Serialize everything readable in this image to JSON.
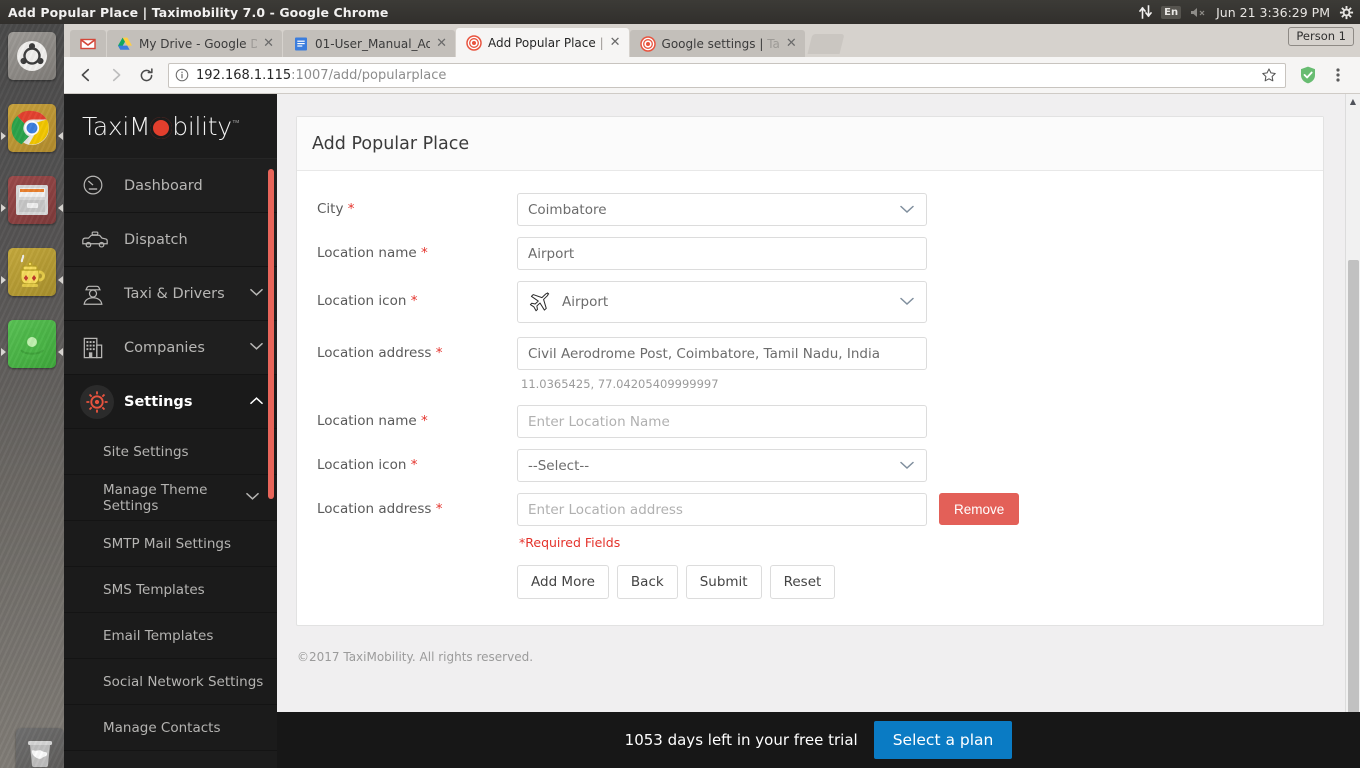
{
  "os_panel": {
    "window_title": "Add Popular Place | Taximobility 7.0 - Google Chrome",
    "tray": {
      "network_icon": "network-updown-icon",
      "keyboard_layout": "En",
      "volume_icon": "volume-muted-icon",
      "clock": "Jun 21  3:36:29 PM",
      "system_icon": "system-gear-icon"
    }
  },
  "launcher": {
    "items": [
      {
        "name": "ubuntu-dash-icon",
        "label": "Ubuntu Dash"
      },
      {
        "name": "google-chrome-icon",
        "label": "Google Chrome"
      },
      {
        "name": "file-manager-icon",
        "label": "Files"
      },
      {
        "name": "genymotion-icon",
        "label": "Genymotion"
      },
      {
        "name": "android-studio-icon",
        "label": "Android Emulator"
      }
    ],
    "trash": {
      "name": "trash-icon",
      "label": "Trash"
    }
  },
  "browser": {
    "tabs": [
      {
        "title": "",
        "favicon": "gmail-icon",
        "active": false,
        "closable": false
      },
      {
        "title": "My Drive - Google ",
        "title_dim": "D",
        "favicon": "google-drive-icon",
        "active": false,
        "closable": true
      },
      {
        "title": "01-User_Manual_Ad",
        "title_dim": "",
        "favicon": "google-docs-icon",
        "active": false,
        "closable": true
      },
      {
        "title": "Add Popular Place ",
        "title_dim": "|",
        "favicon": "taximobility-icon",
        "active": true,
        "closable": true
      },
      {
        "title": "Google settings | ",
        "title_dim": "Ta",
        "favicon": "taximobility-icon",
        "active": false,
        "closable": true
      }
    ],
    "new_tab_label": "+",
    "profile_label": "Person 1",
    "toolbar": {
      "back_icon": "back-arrow-icon",
      "forward_icon": "forward-arrow-icon",
      "reload_icon": "reload-icon",
      "info_icon": "page-info-icon",
      "url_host": "192.168.1.115",
      "url_rest": ":1007/add/popularplace",
      "bookmark_icon": "star-icon",
      "extension_icon": "shield-extension-icon",
      "menu_icon": "three-dot-menu-icon"
    }
  },
  "sidebar": {
    "brand": {
      "pre": "TaxiM",
      "post": "bility",
      "tm": "™"
    },
    "items": [
      {
        "label": "Dashboard",
        "icon": "speedometer-icon",
        "expandable": false,
        "active": false
      },
      {
        "label": "Dispatch",
        "icon": "taxi-icon",
        "expandable": false,
        "active": false
      },
      {
        "label": "Taxi & Drivers",
        "icon": "driver-icon",
        "expandable": true,
        "chevron": "down",
        "active": false
      },
      {
        "label": "Companies",
        "icon": "building-icon",
        "expandable": true,
        "chevron": "down",
        "active": false
      },
      {
        "label": "Settings",
        "icon": "gear-icon",
        "expandable": true,
        "chevron": "up",
        "active": true
      }
    ],
    "subitems": [
      {
        "label": "Site Settings",
        "expandable": false
      },
      {
        "label": "Manage Theme Settings",
        "expandable": true,
        "chevron": "down"
      },
      {
        "label": "SMTP Mail Settings",
        "expandable": false
      },
      {
        "label": "SMS Templates",
        "expandable": false
      },
      {
        "label": "Email Templates",
        "expandable": false
      },
      {
        "label": "Social Network Settings",
        "expandable": false
      },
      {
        "label": "Manage Contacts",
        "expandable": false
      }
    ],
    "scrollbar_color": "#e8655a"
  },
  "page": {
    "card_title": "Add Popular Place",
    "fields": {
      "city": {
        "label": "City",
        "required": true,
        "value": "Coimbatore",
        "type": "select"
      },
      "location_name_1": {
        "label": "Location name",
        "required": true,
        "value": "Airport",
        "type": "text"
      },
      "location_icon_1": {
        "label": "Location icon",
        "required": true,
        "value": "Airport",
        "icon": "airplane-icon",
        "type": "select"
      },
      "location_address_1": {
        "label": "Location address",
        "required": true,
        "value": "Civil Aerodrome Post, Coimbatore, Tamil Nadu, India",
        "type": "text"
      },
      "coordinates": "11.0365425, 77.04205409999997",
      "location_name_2": {
        "label": "Location name",
        "required": true,
        "value": "",
        "placeholder": "Enter Location Name",
        "type": "text"
      },
      "location_icon_2": {
        "label": "Location icon",
        "required": true,
        "value": "--Select--",
        "type": "select"
      },
      "location_address_2": {
        "label": "Location address",
        "required": true,
        "value": "",
        "placeholder": "Enter Location address",
        "type": "text"
      }
    },
    "remove_button": "Remove",
    "required_note": "*Required Fields",
    "buttons": [
      {
        "label": "Add More",
        "name": "add-more-button"
      },
      {
        "label": "Back",
        "name": "back-button"
      },
      {
        "label": "Submit",
        "name": "submit-button"
      },
      {
        "label": "Reset",
        "name": "reset-button"
      }
    ],
    "footer": "©2017 TaxiMobility. All rights reserved."
  },
  "trial": {
    "text": "1053 days left in your free trial",
    "cta": "Select a plan",
    "cta_color": "#0a7bc4"
  }
}
